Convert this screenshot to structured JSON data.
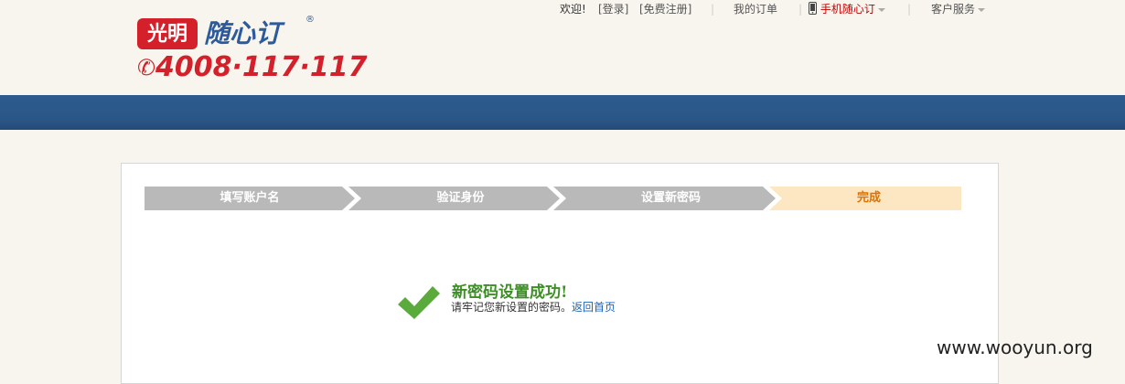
{
  "logo": {
    "brand_box": "光明",
    "brand_text": "随心订",
    "registered": "®",
    "phone": "4008·117·117",
    "phone_icon": "phone-handset-icon"
  },
  "toplinks": {
    "welcome": "欢迎!",
    "login": "[登录]",
    "register": "[免费注册]",
    "separator": "|",
    "my_orders": "我的订单",
    "mobile": "手机随心订",
    "mobile_icon": "mobile-phone-icon",
    "service": "客户服务"
  },
  "steps": [
    {
      "label": "填写账户名"
    },
    {
      "label": "验证身份"
    },
    {
      "label": "设置新密码"
    },
    {
      "label": "完成"
    }
  ],
  "success": {
    "icon": "checkmark-icon",
    "title": "新密码设置成功!",
    "desc": "请牢记您新设置的密码。",
    "link": "返回首页"
  },
  "watermark": "www.wooyun.org",
  "colors": {
    "nav": "#2e5b8e",
    "brand_red": "#d4202a",
    "step_done": "#b9b9b9",
    "step_active": "#fde7c2",
    "success_green": "#3c8f24"
  }
}
